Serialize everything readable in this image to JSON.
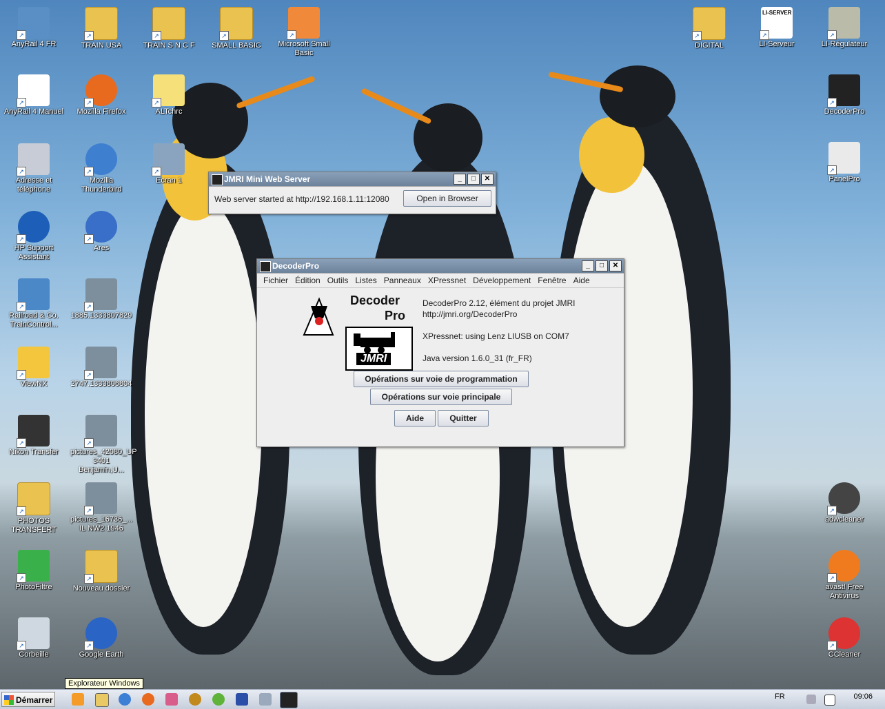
{
  "desktop": {
    "icons_left": [
      {
        "label": "AnyRail 4 FR",
        "icon": "anyrail-icon"
      },
      {
        "label": "TRAIN USA",
        "icon": "folder-star-icon"
      },
      {
        "label": "TRAIN S N C F",
        "icon": "folder-star-icon"
      },
      {
        "label": "SMALL BASIC",
        "icon": "folder-icon"
      },
      {
        "label": "Microsoft Small Basic",
        "icon": "small-basic-icon"
      },
      {
        "label": "AnyRail 4 Manuel",
        "icon": "pdf-icon"
      },
      {
        "label": "Mozilla Firefox",
        "icon": "firefox-icon"
      },
      {
        "label": "ALTchrc",
        "icon": "file-icon"
      },
      {
        "label": "Adresse et téléphone",
        "icon": "phone-icon"
      },
      {
        "label": "Mozilla Thunderbird",
        "icon": "thunderbird-icon"
      },
      {
        "label": "Ecran 1",
        "icon": "image-icon"
      },
      {
        "label": "HP Support Assistant",
        "icon": "help-icon"
      },
      {
        "label": "Ares",
        "icon": "ares-icon"
      },
      {
        "label": "Railroad & Co. TrainControl...",
        "icon": "railroad-icon"
      },
      {
        "label": "1885.1333807829",
        "icon": "photo-icon"
      },
      {
        "label": "ViewNX",
        "icon": "viewnx-icon"
      },
      {
        "label": "2747.1333806804",
        "icon": "photo-icon"
      },
      {
        "label": "Nikon Transfer",
        "icon": "nikon-icon"
      },
      {
        "label": "pictures_42080_UP 3401 Benjamin,U...",
        "icon": "photo-icon"
      },
      {
        "label": "PHOTOS TRANSFERT",
        "icon": "folder-photo-icon"
      },
      {
        "label": "pictures_16736_... IL NW2 1946",
        "icon": "photo-icon"
      },
      {
        "label": "PhotoFiltre",
        "icon": "photofiltre-icon"
      },
      {
        "label": "Nouveau dossier",
        "icon": "folder-icon"
      },
      {
        "label": "Corbeille",
        "icon": "recycle-bin-icon"
      },
      {
        "label": "Google Earth",
        "icon": "google-earth-icon"
      }
    ],
    "icons_right": [
      {
        "label": "DIGITAL",
        "icon": "folder-icon"
      },
      {
        "label": "LI-Serveur",
        "icon": "lenz-icon",
        "badge": "LI-SERVER"
      },
      {
        "label": "LI-Régulateur",
        "icon": "regulator-icon"
      },
      {
        "label": "DecoderPro",
        "icon": "jmri-icon"
      },
      {
        "label": "PanelPro",
        "icon": "panelpro-icon"
      },
      {
        "label": "adwcleaner",
        "icon": "adwcleaner-icon"
      },
      {
        "label": "avast! Free Antivirus",
        "icon": "avast-icon"
      },
      {
        "label": "CCleaner",
        "icon": "ccleaner-icon"
      }
    ]
  },
  "webserver_window": {
    "title": "JMRI Mini Web Server",
    "message": "Web server started at http://192.168.1.11:12080",
    "open_button": "Open in Browser"
  },
  "decoderpro_window": {
    "title": "DecoderPro",
    "menu": [
      "Fichier",
      "Édition",
      "Outils",
      "Listes",
      "Panneaux",
      "XPressnet",
      "Développement",
      "Fenêtre",
      "Aide"
    ],
    "logo_text_1": "Decoder",
    "logo_text_2": "Pro",
    "logo_jmri": "JMRI",
    "version_line": "DecoderPro 2.12, élément du projet JMRI",
    "url_line": "http://jmri.org/DecoderPro",
    "connection_line": "XPressnet: using Lenz LIUSB on COM7",
    "java_line": "Java version 1.6.0_31 (fr_FR)",
    "btn_programming": "Opérations sur voie de programmation",
    "btn_main": "Opérations sur voie principale",
    "btn_help": "Aide",
    "btn_quit": "Quitter"
  },
  "taskbar": {
    "start_label": "Démarrer",
    "tooltip": "Explorateur Windows",
    "language": "FR",
    "clock": "09:06"
  },
  "colors": {
    "sky": "#7fb0d9",
    "titlebar_active": "#d6d6d6",
    "titlebar_inactive": "#6d839c",
    "button_border": "#7b8aa0"
  }
}
